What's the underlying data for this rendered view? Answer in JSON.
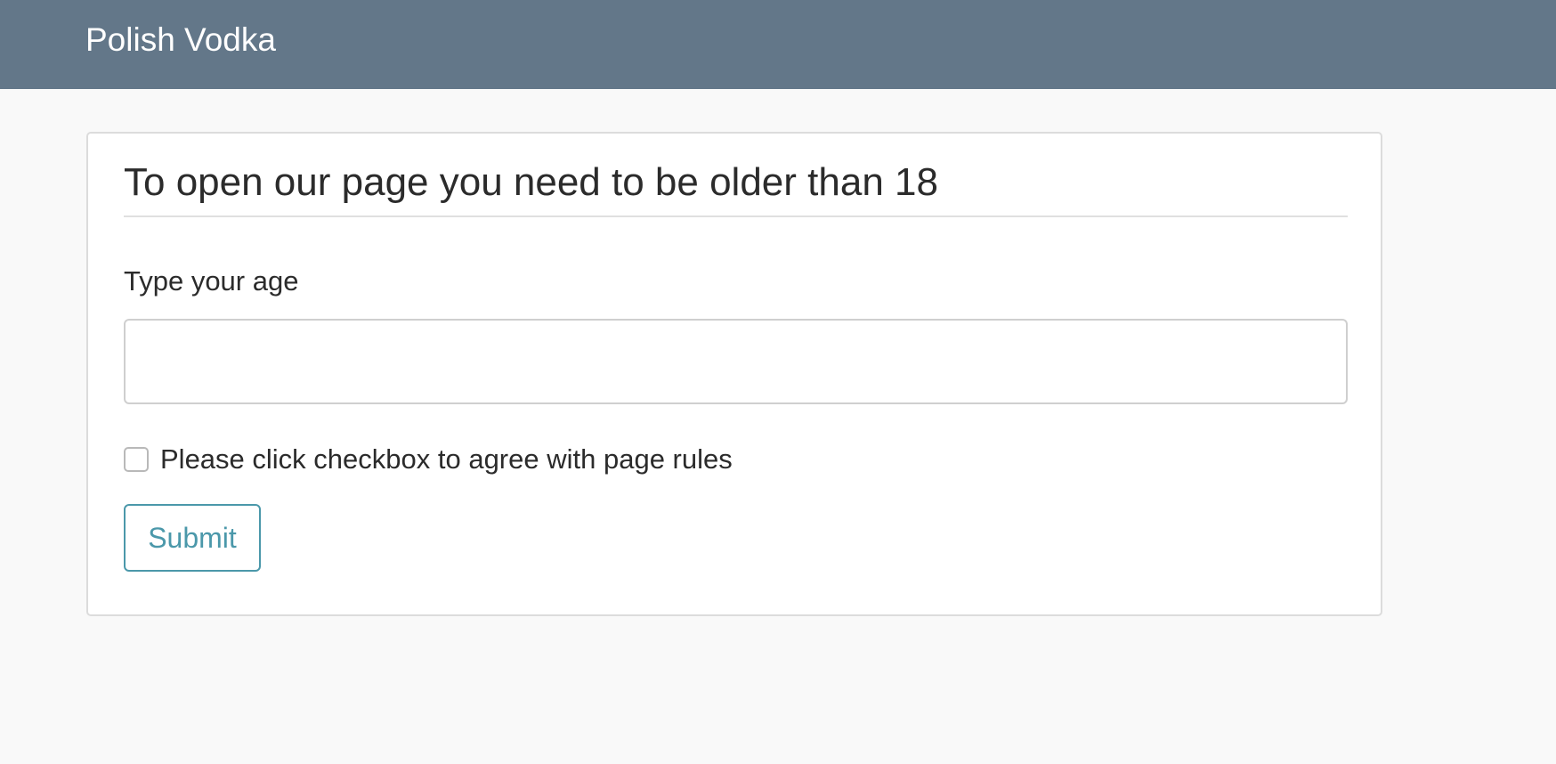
{
  "navbar": {
    "brand": "Polish Vodka"
  },
  "card": {
    "title": "To open our page you need to be older than 18",
    "age_label": "Type your age",
    "age_value": "",
    "age_placeholder": "",
    "checkbox_label": "Please click checkbox to agree with page rules",
    "checkbox_checked": false,
    "submit_label": "Submit"
  },
  "colors": {
    "navbar_bg": "#637789",
    "page_bg": "#f9f9f9",
    "accent": "#4b98aa"
  }
}
